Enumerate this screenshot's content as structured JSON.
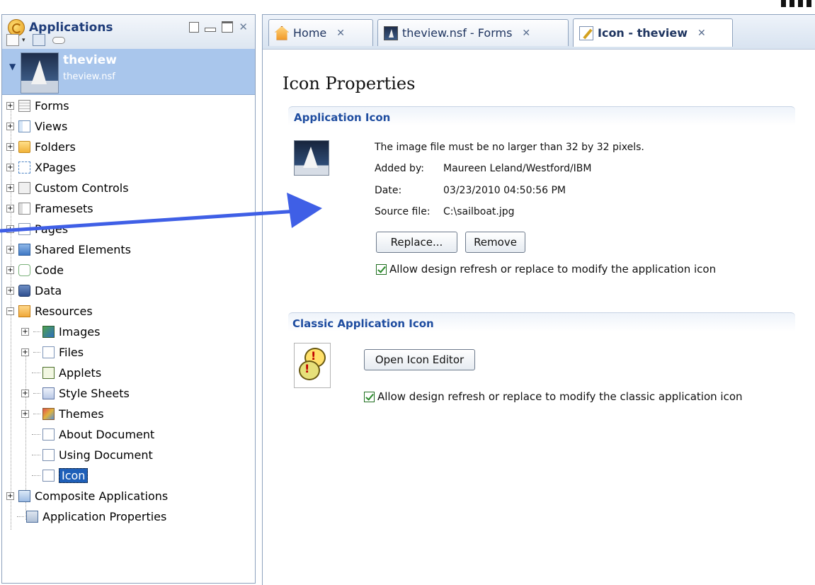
{
  "left_panel": {
    "title": "Applications",
    "database": {
      "title": "theview",
      "file": "theview.nsf"
    },
    "tree": [
      {
        "label": "Forms",
        "icon": "form-icon"
      },
      {
        "label": "Views",
        "icon": "view-icon"
      },
      {
        "label": "Folders",
        "icon": "folder-icon"
      },
      {
        "label": "XPages",
        "icon": "xpages-icon"
      },
      {
        "label": "Custom Controls",
        "icon": "custom-controls-icon"
      },
      {
        "label": "Framesets",
        "icon": "frameset-icon"
      },
      {
        "label": "Pages",
        "icon": "page-icon"
      },
      {
        "label": "Shared Elements",
        "icon": "shared-elements-icon"
      },
      {
        "label": "Code",
        "icon": "code-icon"
      },
      {
        "label": "Data",
        "icon": "data-icon"
      },
      {
        "label": "Resources",
        "icon": "resources-icon"
      },
      {
        "label": "Images",
        "icon": "images-icon"
      },
      {
        "label": "Files",
        "icon": "files-icon"
      },
      {
        "label": "Applets",
        "icon": "applets-icon"
      },
      {
        "label": "Style Sheets",
        "icon": "style-sheets-icon"
      },
      {
        "label": "Themes",
        "icon": "themes-icon"
      },
      {
        "label": "About Document",
        "icon": "about-document-icon"
      },
      {
        "label": "Using Document",
        "icon": "using-document-icon"
      },
      {
        "label": "Icon",
        "icon": "icon-design-icon"
      },
      {
        "label": "Composite Applications",
        "icon": "composite-applications-icon"
      },
      {
        "label": "Application Properties",
        "icon": "application-properties-icon"
      }
    ]
  },
  "tabs": [
    {
      "label": "Home",
      "icon": "home-icon"
    },
    {
      "label": "theview.nsf - Forms",
      "icon": "sailboat-icon"
    },
    {
      "label": "Icon - theview",
      "icon": "edit-icon"
    }
  ],
  "main": {
    "page_title": "Icon Properties",
    "app_icon_section": {
      "heading": "Application Icon",
      "note": "The image file must be no larger than 32 by 32 pixels.",
      "added_by_label": "Added by:",
      "added_by_value": "Maureen Leland/Westford/IBM",
      "date_label": "Date:",
      "date_value": "03/23/2010 04:50:56 PM",
      "source_label": "Source file:",
      "source_value": "C:\\sailboat.jpg",
      "replace_label": "Replace...",
      "remove_label": "Remove",
      "allow_refresh_label": "Allow design refresh or replace to modify the application icon",
      "allow_refresh_checked": true
    },
    "classic_section": {
      "heading": "Classic Application Icon",
      "open_editor_label": "Open Icon Editor",
      "allow_refresh_label": "Allow design refresh or replace to modify the classic application icon",
      "allow_refresh_checked": true
    }
  },
  "colors": {
    "selection_row": "#a9c6ec",
    "heading_blue": "#1f4da0",
    "arrow": "#3f5fe6"
  }
}
